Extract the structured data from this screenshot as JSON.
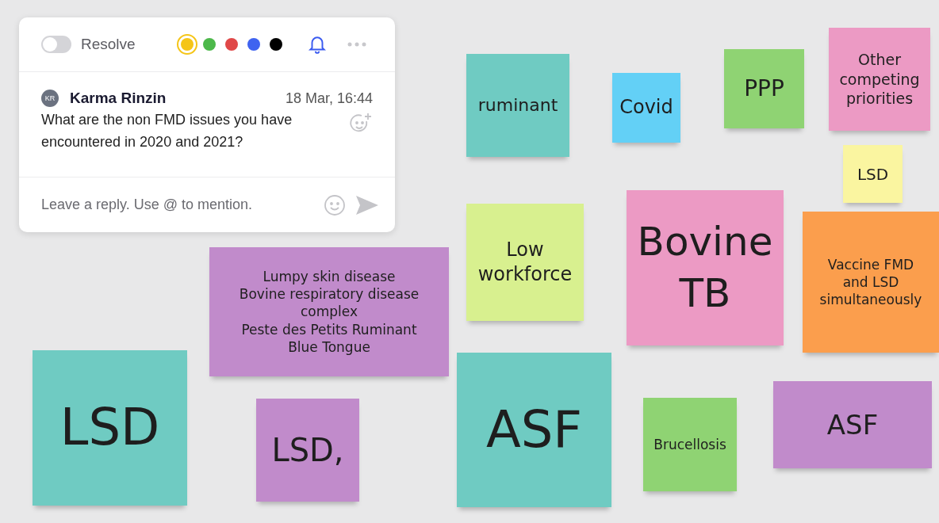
{
  "comment": {
    "resolve": {
      "label": "Resolve",
      "on": false
    },
    "colors": [
      {
        "color": "#f5c518",
        "selected": true
      },
      {
        "color": "#4cb84a",
        "selected": false
      },
      {
        "color": "#e04848",
        "selected": false
      },
      {
        "color": "#3f63f0",
        "selected": false
      },
      {
        "color": "#000000",
        "selected": false
      }
    ],
    "author": {
      "initials": "KR",
      "name": "Karma Rinzin"
    },
    "time": "18 Mar, 16:44",
    "text": "What are the non FMD issues you have encountered in 2020 and 2021?",
    "reply": {
      "placeholder": "Leave a reply. Use @ to mention."
    }
  },
  "notes": [
    {
      "lines": [
        "ruminant"
      ],
      "color": "#6fcbc2"
    },
    {
      "lines": [
        "Covid"
      ],
      "color": "#63d0f6"
    },
    {
      "lines": [
        "PPP"
      ],
      "color": "#8fd373"
    },
    {
      "lines": [
        "Other competing priorities"
      ],
      "color": "#ec9ac4"
    },
    {
      "lines": [
        "LSD"
      ],
      "color": "#faf5a0"
    },
    {
      "lines": [
        "Low workforce"
      ],
      "color": "#d8f08f"
    },
    {
      "lines": [
        "Bovine TB"
      ],
      "color": "#ec9ac4"
    },
    {
      "lines": [
        "Vaccine FMD and LSD simultaneously"
      ],
      "color": "#fb9e4d"
    },
    {
      "lines": [
        "Lumpy skin disease",
        "Bovine respiratory disease complex",
        "Peste des Petits Ruminant",
        "Blue Tongue"
      ],
      "color": "#c18bcb"
    },
    {
      "lines": [
        "LSD"
      ],
      "color": "#6fcbc2"
    },
    {
      "lines": [
        "LSD,"
      ],
      "color": "#c18bcb"
    },
    {
      "lines": [
        "ASF"
      ],
      "color": "#6fcbc2"
    },
    {
      "lines": [
        "Brucellosis"
      ],
      "color": "#8fd373"
    },
    {
      "lines": [
        "ASF"
      ],
      "color": "#c18bcb"
    }
  ]
}
